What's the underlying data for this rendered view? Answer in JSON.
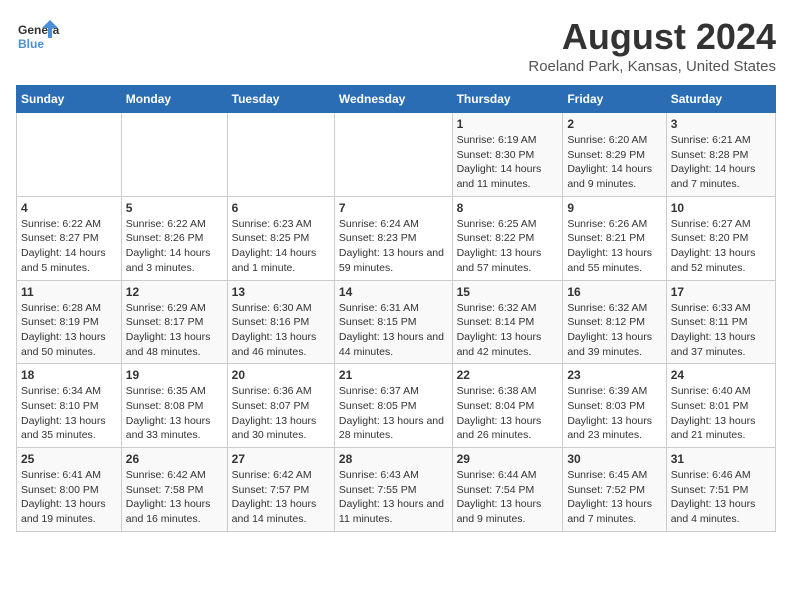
{
  "logo": {
    "line1": "General",
    "line2": "Blue"
  },
  "title": "August 2024",
  "subtitle": "Roeland Park, Kansas, United States",
  "days_of_week": [
    "Sunday",
    "Monday",
    "Tuesday",
    "Wednesday",
    "Thursday",
    "Friday",
    "Saturday"
  ],
  "weeks": [
    [
      {
        "day": "",
        "info": ""
      },
      {
        "day": "",
        "info": ""
      },
      {
        "day": "",
        "info": ""
      },
      {
        "day": "",
        "info": ""
      },
      {
        "day": "1",
        "info": "Sunrise: 6:19 AM\nSunset: 8:30 PM\nDaylight: 14 hours and 11 minutes."
      },
      {
        "day": "2",
        "info": "Sunrise: 6:20 AM\nSunset: 8:29 PM\nDaylight: 14 hours and 9 minutes."
      },
      {
        "day": "3",
        "info": "Sunrise: 6:21 AM\nSunset: 8:28 PM\nDaylight: 14 hours and 7 minutes."
      }
    ],
    [
      {
        "day": "4",
        "info": "Sunrise: 6:22 AM\nSunset: 8:27 PM\nDaylight: 14 hours and 5 minutes."
      },
      {
        "day": "5",
        "info": "Sunrise: 6:22 AM\nSunset: 8:26 PM\nDaylight: 14 hours and 3 minutes."
      },
      {
        "day": "6",
        "info": "Sunrise: 6:23 AM\nSunset: 8:25 PM\nDaylight: 14 hours and 1 minute."
      },
      {
        "day": "7",
        "info": "Sunrise: 6:24 AM\nSunset: 8:23 PM\nDaylight: 13 hours and 59 minutes."
      },
      {
        "day": "8",
        "info": "Sunrise: 6:25 AM\nSunset: 8:22 PM\nDaylight: 13 hours and 57 minutes."
      },
      {
        "day": "9",
        "info": "Sunrise: 6:26 AM\nSunset: 8:21 PM\nDaylight: 13 hours and 55 minutes."
      },
      {
        "day": "10",
        "info": "Sunrise: 6:27 AM\nSunset: 8:20 PM\nDaylight: 13 hours and 52 minutes."
      }
    ],
    [
      {
        "day": "11",
        "info": "Sunrise: 6:28 AM\nSunset: 8:19 PM\nDaylight: 13 hours and 50 minutes."
      },
      {
        "day": "12",
        "info": "Sunrise: 6:29 AM\nSunset: 8:17 PM\nDaylight: 13 hours and 48 minutes."
      },
      {
        "day": "13",
        "info": "Sunrise: 6:30 AM\nSunset: 8:16 PM\nDaylight: 13 hours and 46 minutes."
      },
      {
        "day": "14",
        "info": "Sunrise: 6:31 AM\nSunset: 8:15 PM\nDaylight: 13 hours and 44 minutes."
      },
      {
        "day": "15",
        "info": "Sunrise: 6:32 AM\nSunset: 8:14 PM\nDaylight: 13 hours and 42 minutes."
      },
      {
        "day": "16",
        "info": "Sunrise: 6:32 AM\nSunset: 8:12 PM\nDaylight: 13 hours and 39 minutes."
      },
      {
        "day": "17",
        "info": "Sunrise: 6:33 AM\nSunset: 8:11 PM\nDaylight: 13 hours and 37 minutes."
      }
    ],
    [
      {
        "day": "18",
        "info": "Sunrise: 6:34 AM\nSunset: 8:10 PM\nDaylight: 13 hours and 35 minutes."
      },
      {
        "day": "19",
        "info": "Sunrise: 6:35 AM\nSunset: 8:08 PM\nDaylight: 13 hours and 33 minutes."
      },
      {
        "day": "20",
        "info": "Sunrise: 6:36 AM\nSunset: 8:07 PM\nDaylight: 13 hours and 30 minutes."
      },
      {
        "day": "21",
        "info": "Sunrise: 6:37 AM\nSunset: 8:05 PM\nDaylight: 13 hours and 28 minutes."
      },
      {
        "day": "22",
        "info": "Sunrise: 6:38 AM\nSunset: 8:04 PM\nDaylight: 13 hours and 26 minutes."
      },
      {
        "day": "23",
        "info": "Sunrise: 6:39 AM\nSunset: 8:03 PM\nDaylight: 13 hours and 23 minutes."
      },
      {
        "day": "24",
        "info": "Sunrise: 6:40 AM\nSunset: 8:01 PM\nDaylight: 13 hours and 21 minutes."
      }
    ],
    [
      {
        "day": "25",
        "info": "Sunrise: 6:41 AM\nSunset: 8:00 PM\nDaylight: 13 hours and 19 minutes."
      },
      {
        "day": "26",
        "info": "Sunrise: 6:42 AM\nSunset: 7:58 PM\nDaylight: 13 hours and 16 minutes."
      },
      {
        "day": "27",
        "info": "Sunrise: 6:42 AM\nSunset: 7:57 PM\nDaylight: 13 hours and 14 minutes."
      },
      {
        "day": "28",
        "info": "Sunrise: 6:43 AM\nSunset: 7:55 PM\nDaylight: 13 hours and 11 minutes."
      },
      {
        "day": "29",
        "info": "Sunrise: 6:44 AM\nSunset: 7:54 PM\nDaylight: 13 hours and 9 minutes."
      },
      {
        "day": "30",
        "info": "Sunrise: 6:45 AM\nSunset: 7:52 PM\nDaylight: 13 hours and 7 minutes."
      },
      {
        "day": "31",
        "info": "Sunrise: 6:46 AM\nSunset: 7:51 PM\nDaylight: 13 hours and 4 minutes."
      }
    ]
  ]
}
